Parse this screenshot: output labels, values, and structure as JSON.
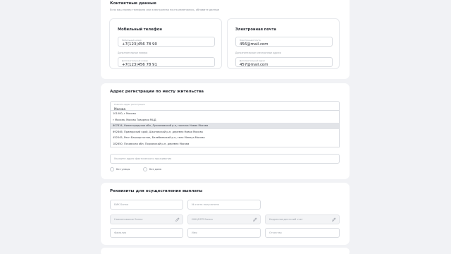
{
  "contacts": {
    "title": "Контактные данные",
    "subtitle": "Если ваш номер телефона или электронная почта изменились, обновите данные",
    "mobile": {
      "title": "Мобильный телефон",
      "main_label": "Мобильный номер",
      "main_value": "+7(123)456 78 90",
      "extra_outer_label": "Дополнительные номера",
      "extra_label": "Дополнительный номер",
      "extra_value": "+7(123)456 78 91"
    },
    "email": {
      "title": "Электронная почта",
      "main_label": "Электронная почта",
      "main_value": "456@mail.com",
      "extra_outer_label": "Дополнительные электронные адреса",
      "extra_label": "Дополнительный адрес",
      "extra_value": "457@mail.com"
    }
  },
  "address": {
    "title": "Адрес регистрации по месту жительства",
    "input_label": "Укажите адрес регистрации",
    "input_value": "Москва",
    "suggestions": [
      "101000, г Москва",
      "г Москва, Москва Товарная МЦД",
      "607814, Нижегородская обл, Лукояновский р-н, поселок Новая Москва",
      "692846, Приморский край, Шкотовский р-н, деревня Новая Москва",
      "452045, Респ Башкортостан, Белебеевский р-н, село Менеуз-Москва",
      "182650, Псковская обл, Порховский р-н, деревня Москва"
    ],
    "actual_placeholder": "Укажите адрес фактического проживания",
    "no_street_label": "Без улицы",
    "no_house_label": "Без дома"
  },
  "bank": {
    "title": "Реквизиты для осуществления выплаты",
    "bik_placeholder": "БИК Банка",
    "account_placeholder": "№ счета получателя",
    "bank_name_placeholder": "Наименование Банка",
    "inn_placeholder": "ИНН/КПП Банка",
    "corr_placeholder": "Корреспондентский счет",
    "surname_placeholder": "Фамилия",
    "name_placeholder": "Имя",
    "patronymic_placeholder": "Отчество"
  },
  "icons": {
    "edit": "pencil-icon"
  },
  "colors": {
    "page_bg": "#f1f2f5",
    "highlight": "#e2e4e8"
  }
}
